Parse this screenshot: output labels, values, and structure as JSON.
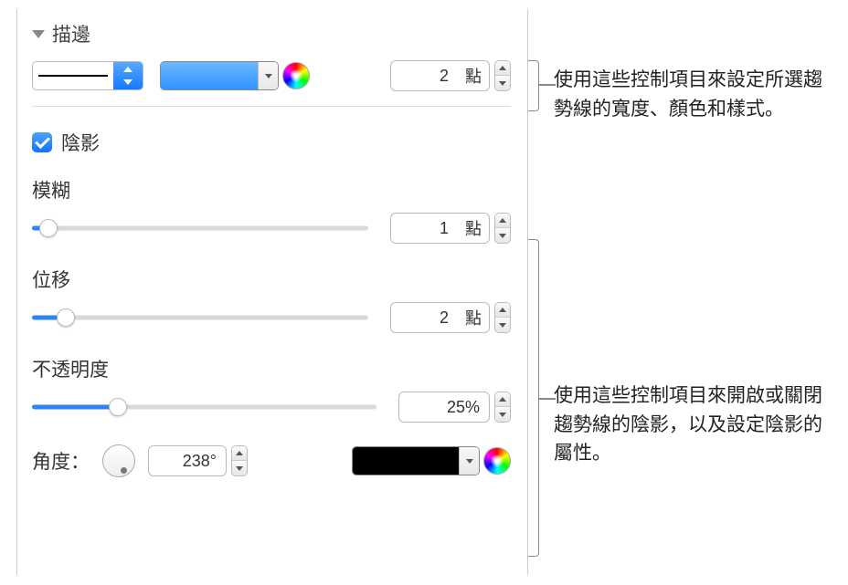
{
  "stroke": {
    "section_label": "描邊",
    "width_value": "2",
    "width_unit": "點"
  },
  "shadow": {
    "checkbox_label": "陰影",
    "blur": {
      "label": "模糊",
      "value": "1",
      "unit": "點",
      "percent": 5
    },
    "offset": {
      "label": "位移",
      "value": "2",
      "unit": "點",
      "percent": 10
    },
    "opacity": {
      "label": "不透明度",
      "value": "25%",
      "percent": 25
    },
    "angle": {
      "label": "角度：",
      "value": "238°"
    }
  },
  "callouts": {
    "stroke": "使用這些控制項目來設定所選趨勢線的寬度、顏色和樣式。",
    "shadow": "使用這些控制項目來開啟或關閉趨勢線的陰影，以及設定陰影的屬性。"
  }
}
